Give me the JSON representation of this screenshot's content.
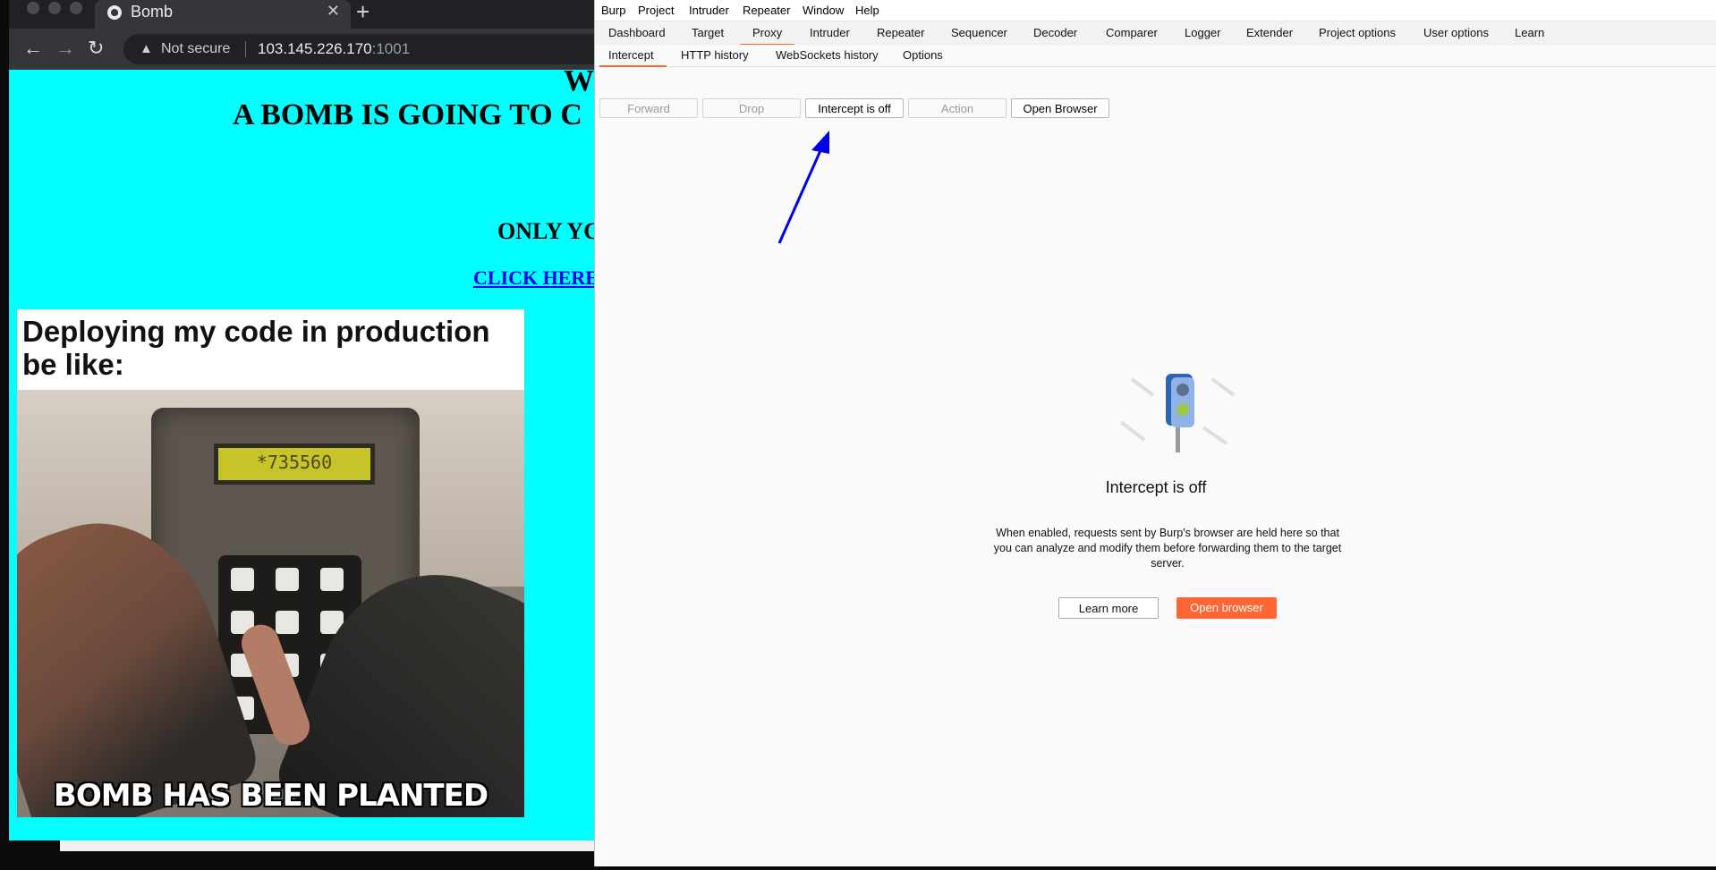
{
  "browser": {
    "tab_title": "Bomb",
    "close_glyph": "✕",
    "new_tab_glyph": "+",
    "back_glyph": "←",
    "forward_glyph": "→",
    "reload_glyph": "↻",
    "warning_glyph": "▲",
    "security_label": "Not secure",
    "url_host": "103.145.226.170",
    "url_port": ":1001"
  },
  "webpage": {
    "heading_partial": "W",
    "heading_line2": "A BOMB IS GOING TO C",
    "only_text": "ONLY YC",
    "click_link": "CLICK HERE",
    "meme_caption": "Deploying my code in production be like:",
    "lcd_text": "*735560",
    "meme_bottom": "BOMB HAS BEEN PLANTED"
  },
  "burp": {
    "menu": [
      "Burp",
      "Project",
      "Intruder",
      "Repeater",
      "Window",
      "Help"
    ],
    "main_tabs": [
      "Dashboard",
      "Target",
      "Proxy",
      "Intruder",
      "Repeater",
      "Sequencer",
      "Decoder",
      "Comparer",
      "Logger",
      "Extender",
      "Project options",
      "User options",
      "Learn"
    ],
    "active_main_tab": "Proxy",
    "sub_tabs": [
      "Intercept",
      "HTTP history",
      "WebSockets history",
      "Options"
    ],
    "active_sub_tab": "Intercept",
    "proxy_buttons": {
      "forward": "Forward",
      "drop": "Drop",
      "intercept_toggle": "Intercept is off",
      "action": "Action",
      "open_browser": "Open Browser"
    },
    "intercept_title": "Intercept is off",
    "intercept_description": "When enabled, requests sent by Burp's browser are held here so that you can analyze and modify them before forwarding them to the target server.",
    "learn_more": "Learn more",
    "open_browser_cta": "Open browser",
    "accent_color": "#ff6633"
  },
  "annotation": {
    "arrow_color": "#0000ee",
    "icon": "arrow-up-right-icon"
  }
}
